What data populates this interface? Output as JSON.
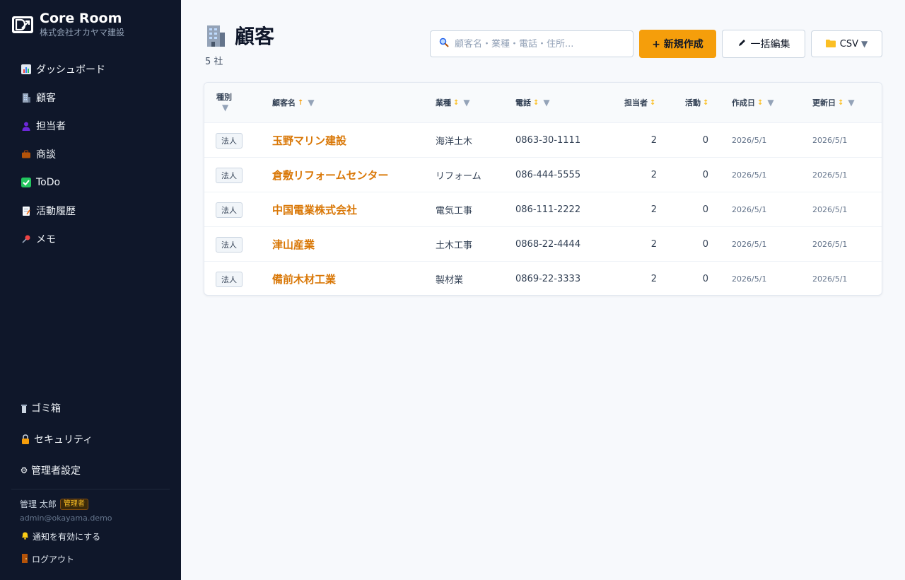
{
  "brand": {
    "name": "Core Room",
    "company": "株式会社オカヤマ建設"
  },
  "sidebar": {
    "items": [
      {
        "label": "ダッシュボード",
        "icon": "bar-chart-icon"
      },
      {
        "label": "顧客",
        "icon": "building-icon"
      },
      {
        "label": "担当者",
        "icon": "person-icon"
      },
      {
        "label": "商談",
        "icon": "briefcase-icon"
      },
      {
        "label": "ToDo",
        "icon": "check-box-icon"
      },
      {
        "label": "活動履歴",
        "icon": "memo-icon"
      },
      {
        "label": "メモ",
        "icon": "pushpin-icon"
      }
    ],
    "bottom": [
      {
        "label": "ゴミ箱",
        "icon": "trash-icon"
      },
      {
        "label": "セキュリティ",
        "icon": "lock-icon"
      },
      {
        "label": "管理者設定",
        "icon": "gear-icon"
      }
    ],
    "user": {
      "name": "管理 太郎",
      "role": "管理者",
      "email": "admin@okayama.demo"
    },
    "notify_label": "通知を有効にする",
    "logout_label": "ログアウト"
  },
  "page": {
    "title": "顧客",
    "count": "5 社"
  },
  "toolbar": {
    "search_placeholder": "顧客名・業種・電話・住所...",
    "new_label": "+ 新規作成",
    "bulk_edit_label": "一括編集",
    "csv_label": "CSV"
  },
  "table": {
    "headers": {
      "type": "種別",
      "name": "顧客名",
      "industry": "業種",
      "phone": "電話",
      "contacts": "担当者",
      "activity": "活動",
      "created": "作成日",
      "updated": "更新日"
    },
    "rows": [
      {
        "type": "法人",
        "name": "玉野マリン建設",
        "industry": "海洋土木",
        "phone": "0863-30-1111",
        "contacts": "2",
        "activity": "0",
        "created": "2026/5/1",
        "updated": "2026/5/1"
      },
      {
        "type": "法人",
        "name": "倉敷リフォームセンター",
        "industry": "リフォーム",
        "phone": "086-444-5555",
        "contacts": "2",
        "activity": "0",
        "created": "2026/5/1",
        "updated": "2026/5/1"
      },
      {
        "type": "法人",
        "name": "中国電業株式会社",
        "industry": "電気工事",
        "phone": "086-111-2222",
        "contacts": "2",
        "activity": "0",
        "created": "2026/5/1",
        "updated": "2026/5/1"
      },
      {
        "type": "法人",
        "name": "津山産業",
        "industry": "土木工事",
        "phone": "0868-22-4444",
        "contacts": "2",
        "activity": "0",
        "created": "2026/5/1",
        "updated": "2026/5/1"
      },
      {
        "type": "法人",
        "name": "備前木材工業",
        "industry": "製材業",
        "phone": "0869-22-3333",
        "contacts": "2",
        "activity": "0",
        "created": "2026/5/1",
        "updated": "2026/5/1"
      }
    ]
  },
  "colors": {
    "sidebar_bg": "#0f172a",
    "accent": "#f59e0b",
    "link": "#d97706"
  }
}
